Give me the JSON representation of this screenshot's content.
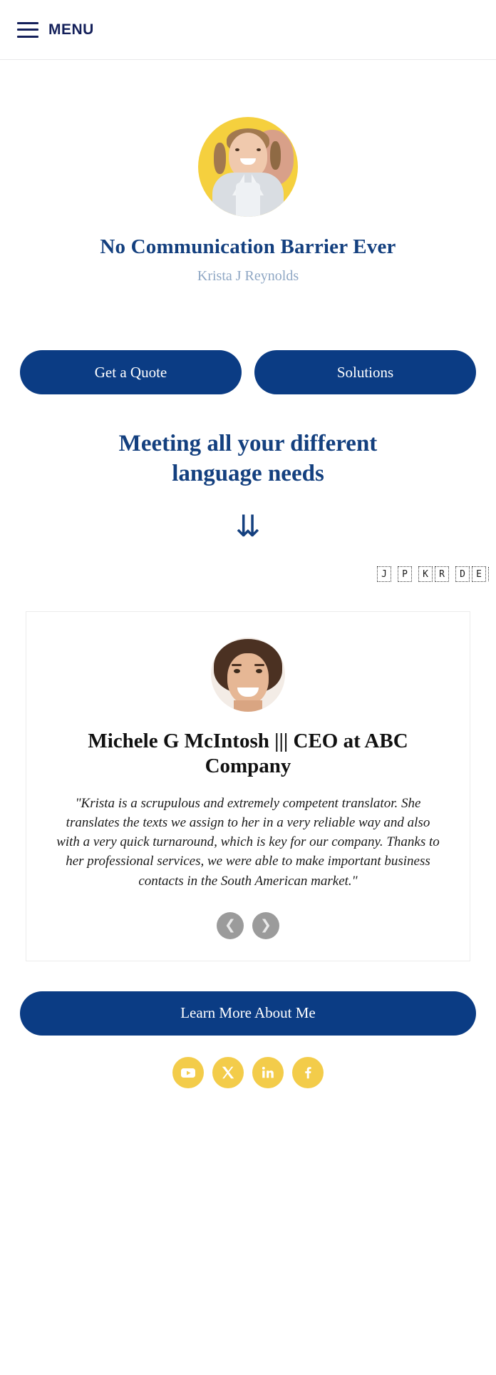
{
  "header": {
    "menu_label": "MENU",
    "menu_icon": "hamburger-icon",
    "accent_color": "#14205a"
  },
  "hero": {
    "avatar_icon": "profile-photo",
    "title": "No Communication Barrier Ever",
    "subtitle": "Krista J Reynolds",
    "title_color": "#14407f",
    "subtitle_color": "#8fa7c4"
  },
  "cta": {
    "primary_label": "Get a Quote",
    "secondary_label": "Solutions",
    "button_color": "#0b3c84"
  },
  "tagline": {
    "text": "Meeting all your different language needs",
    "arrow_icon": "triple-down-arrow-icon",
    "arrow_glyph": "⇊"
  },
  "flags": {
    "items": [
      "J",
      "P",
      "K",
      "R",
      "D",
      "E"
    ],
    "note": "missing-glyph boxes"
  },
  "testimonial": {
    "avatar_icon": "testimonial-photo",
    "name": "Michele G McIntosh ||| CEO at ABC Company",
    "quote": "\"Krista is a scrupulous and extremely competent translator. She translates the texts we assign to her in a very reliable way and also with a very quick turnaround, which is key for our company. Thanks to her professional services, we were able to make important business contacts in the South American market.\"",
    "prev_glyph": "❮",
    "next_glyph": "❯"
  },
  "footer": {
    "learn_more_label": "Learn More About Me",
    "social": [
      {
        "name": "youtube",
        "label": "YouTube"
      },
      {
        "name": "x-twitter",
        "label": "X"
      },
      {
        "name": "linkedin",
        "label": "LinkedIn"
      },
      {
        "name": "facebook",
        "label": "Facebook"
      }
    ],
    "social_color": "#f3cc4a"
  }
}
